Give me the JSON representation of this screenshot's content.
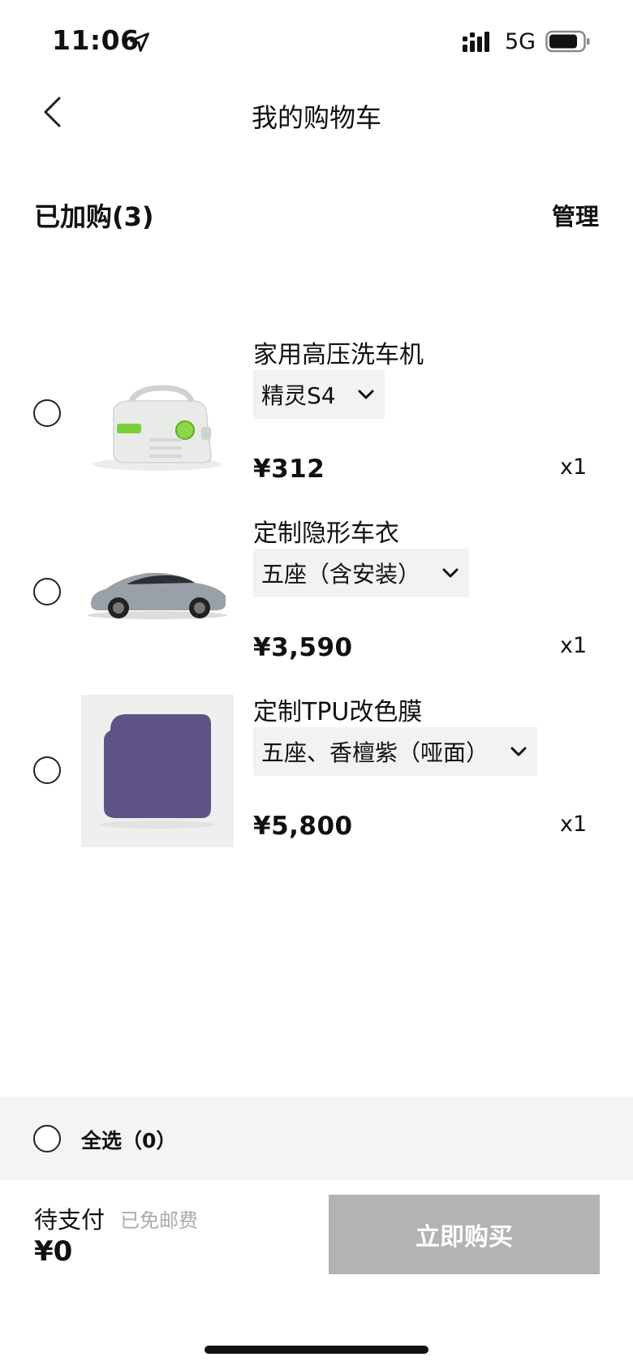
{
  "status_bar": {
    "time": "11:06",
    "network": "5G",
    "icons": [
      "location-arrow-icon",
      "cellular-signal-icon",
      "battery-icon"
    ]
  },
  "nav": {
    "back_icon": "chevron-left-icon",
    "title": "我的购物车"
  },
  "cart": {
    "header": "已加购(3)",
    "manage_label": "管理",
    "items": [
      {
        "name": "家用高压洗车机",
        "variant": "精灵S4",
        "price": "¥312",
        "quantity": "x1",
        "thumb_icon": "pressure-washer-image",
        "selected": false
      },
      {
        "name": "定制隐形车衣",
        "variant": "五座（含安装）",
        "price": "¥3,590",
        "quantity": "x1",
        "thumb_icon": "car-image",
        "selected": false
      },
      {
        "name": "定制TPU改色膜",
        "variant": "五座、香檀紫（哑面）",
        "price": "¥5,800",
        "quantity": "x1",
        "thumb_icon": "purple-swatch-image",
        "thumb_color": "#5f5485",
        "selected": false
      }
    ]
  },
  "footer": {
    "select_all_label": "全选（0）",
    "pay_label": "待支付",
    "shipping_note": "已免邮费",
    "total": "¥0",
    "buy_label": "立即购买",
    "buy_disabled_color": "#b3b3b3"
  }
}
